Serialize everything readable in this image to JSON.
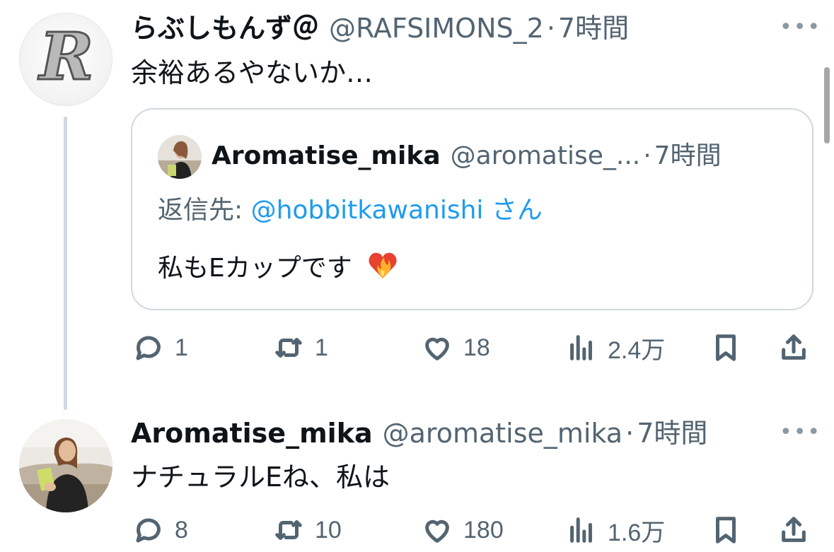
{
  "tweet1": {
    "name": "らぶしもんず＠",
    "handle": "@RAFSIMONS_2",
    "dot": "·",
    "time": "7時間",
    "text": "余裕あるやないか…",
    "avatar_letter": "R"
  },
  "quote": {
    "name": "Aromatise_mika",
    "handle": "@aromatise_...",
    "dot": "·",
    "time": "7時間",
    "reply_prefix": "返信先: ",
    "reply_mention": "@hobbitkawanishi",
    "reply_suffix": " さん",
    "text": "私もEカップです",
    "emoji": "❤️‍🔥"
  },
  "tweet1_actions": {
    "replies": "1",
    "retweets": "1",
    "likes": "18",
    "views": "2.4万"
  },
  "tweet2": {
    "name": "Aromatise_mika",
    "handle": "@aromatise_mika",
    "dot": "·",
    "time": "7時間",
    "text": "ナチュラルEね、私は"
  },
  "tweet2_actions": {
    "replies": "8",
    "retweets": "10",
    "likes": "180",
    "views": "1.6万"
  },
  "more_label": "•••"
}
